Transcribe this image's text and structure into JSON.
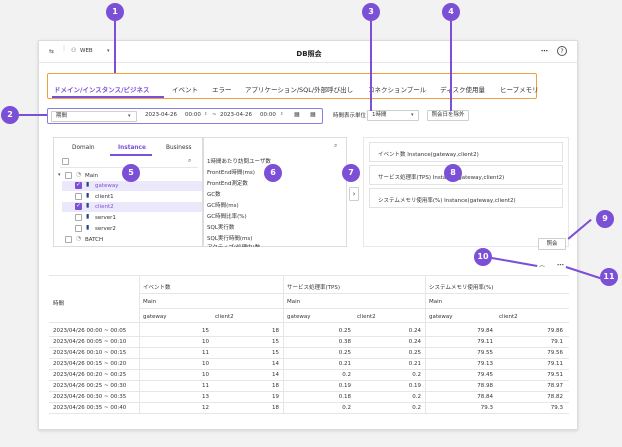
{
  "window": {
    "title": "DB照会",
    "wlabel": "WEB",
    "more": "⋯",
    "help": "?"
  },
  "tabs": [
    {
      "label": "ドメイン/インスタンス/ビジネス",
      "active": true
    },
    {
      "label": "イベント"
    },
    {
      "label": "エラー"
    },
    {
      "label": "アプリケーション/SQL/外部呼び出し"
    },
    {
      "label": "コネクションプール"
    },
    {
      "label": "ディスク使用量"
    },
    {
      "label": "ヒープメモリ"
    }
  ],
  "filter": {
    "period_label": "期間",
    "date_from": "2023-04-26",
    "time_from": "00:00",
    "sep": "~",
    "date_to": "2023-04-26",
    "time_to": "00:00",
    "display_unit_label": "時間表示単位",
    "display_unit_value": "1時間",
    "exclude_button": "照会日を除外"
  },
  "left_panel": {
    "tabs": [
      "Domain",
      "Instance",
      "Business"
    ],
    "tree": [
      {
        "label": "Main",
        "checked": false,
        "level": 0
      },
      {
        "label": "gateway",
        "checked": true,
        "level": 1,
        "selected": true
      },
      {
        "label": "client1",
        "checked": false,
        "level": 1
      },
      {
        "label": "client2",
        "checked": true,
        "level": 1,
        "selected": true
      },
      {
        "label": "server1",
        "checked": false,
        "level": 1
      },
      {
        "label": "server2",
        "checked": false,
        "level": 1
      },
      {
        "label": "BATCH",
        "checked": false,
        "level": 0
      }
    ]
  },
  "metrics": [
    "1時間あたり訪問ユーザ数",
    "FrontEnd時間(ms)",
    "FrontEnd測定数",
    "GC数",
    "GC時間(ms)",
    "GC時間比率(%)",
    "SQL実行数",
    "SQL実行時間(ms)",
    "アクティブ(処理中)数"
  ],
  "mover": "›",
  "selected_charts": [
    "イベント数 Instance(gateway,client2)",
    "サービス処理率(TPS) Instance(gateway,client2)",
    "システムメモリ使用率(%) Instance(gateway,client2)"
  ],
  "query_button": "照会",
  "callouts": [
    "1",
    "2",
    "3",
    "4",
    "5",
    "6",
    "7",
    "8",
    "9",
    "10",
    "11"
  ],
  "table": {
    "time_header": "時間",
    "groups": [
      "イベント数",
      "サービス処理率(TPS)",
      "システムメモリ使用率(%)"
    ],
    "domain": "Main",
    "subcols": [
      "gateway",
      "client2"
    ],
    "rows": [
      [
        "2023/04/26 00:00 ~ 00:05",
        "15",
        "18",
        "0.25",
        "0.24",
        "79.84",
        "79.86"
      ],
      [
        "2023/04/26 00:05 ~ 00:10",
        "10",
        "15",
        "0.38",
        "0.24",
        "79.11",
        "79.1"
      ],
      [
        "2023/04/26 00:10 ~ 00:15",
        "11",
        "15",
        "0.25",
        "0.25",
        "79.55",
        "79.56"
      ],
      [
        "2023/04/26 00:15 ~ 00:20",
        "10",
        "14",
        "0.21",
        "0.21",
        "79.13",
        "79.11"
      ],
      [
        "2023/04/26 00:20 ~ 00:25",
        "10",
        "14",
        "0.2",
        "0.2",
        "79.45",
        "79.51"
      ],
      [
        "2023/04/26 00:25 ~ 00:30",
        "11",
        "18",
        "0.19",
        "0.19",
        "78.98",
        "78.97"
      ],
      [
        "2023/04/26 00:30 ~ 00:35",
        "13",
        "19",
        "0.18",
        "0.2",
        "78.84",
        "78.82"
      ],
      [
        "2023/04/26 00:35 ~ 00:40",
        "12",
        "18",
        "0.2",
        "0.2",
        "79.3",
        "79.3"
      ]
    ]
  }
}
